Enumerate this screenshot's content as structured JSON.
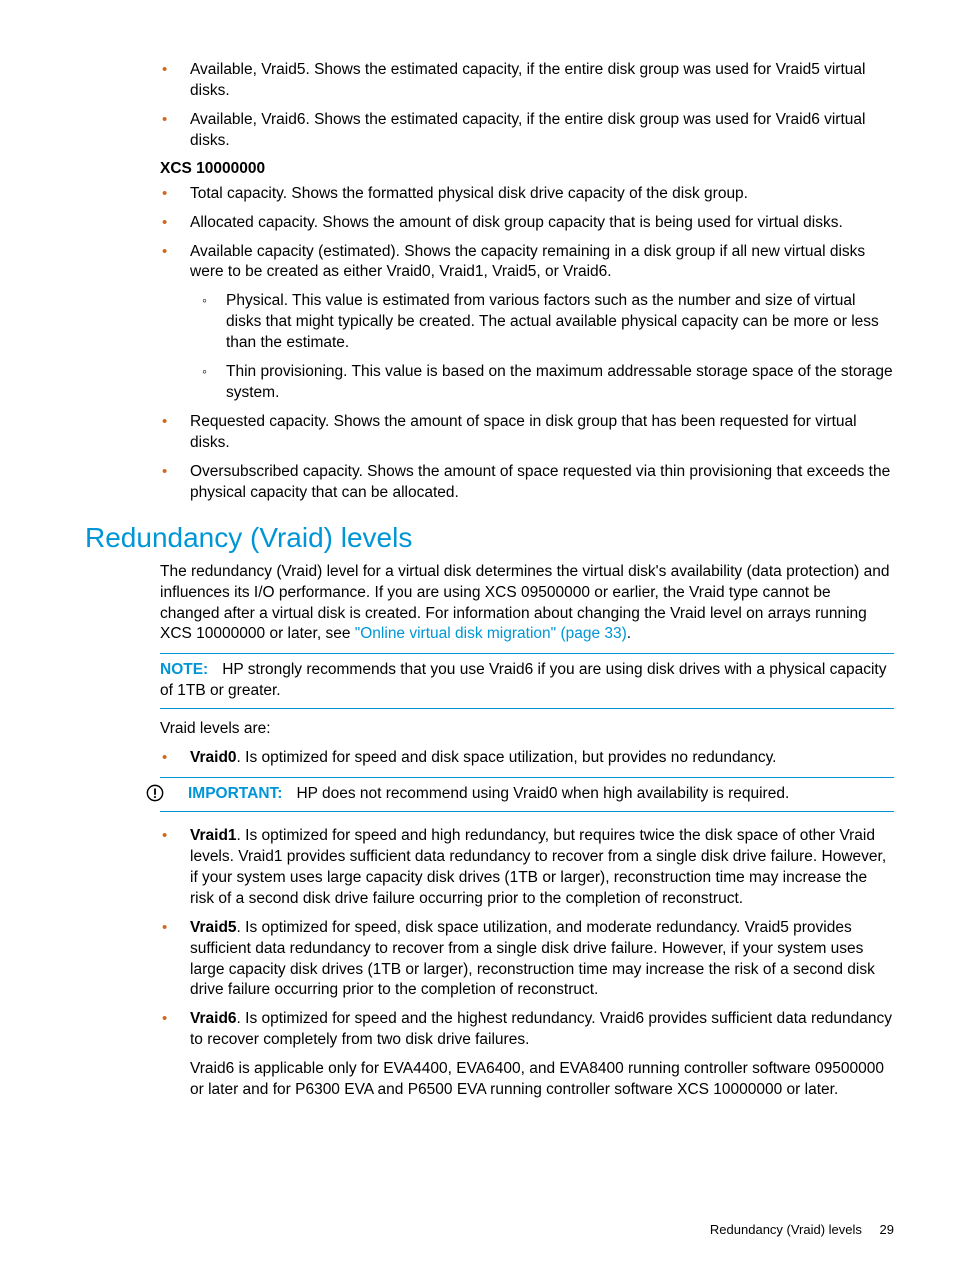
{
  "top_list": [
    "Available, Vraid5. Shows the estimated capacity, if the entire disk group was used for Vraid5 virtual disks.",
    "Available, Vraid6. Shows the estimated capacity, if the entire disk group was used for Vraid6 virtual disks."
  ],
  "xcs_heading": "XCS 10000000",
  "xcs_list": {
    "i0": "Total capacity. Shows the formatted physical disk drive capacity of the disk group.",
    "i1": "Allocated capacity. Shows the amount of disk group capacity that is being used for virtual disks.",
    "i2": "Available capacity (estimated). Shows the capacity remaining in a disk group if all new virtual disks were to be created as either Vraid0, Vraid1, Vraid5, or Vraid6.",
    "i2_sub0": "Physical. This value is estimated from various factors such as the number and size of virtual disks that might typically be created. The actual available physical capacity can be more or less than the estimate.",
    "i2_sub1": "Thin provisioning. This value is based on the maximum addressable storage space of the storage system.",
    "i3": "Requested capacity. Shows the amount of space in disk group that has been requested for virtual disks.",
    "i4": "Oversubscribed capacity. Shows the amount of space requested via thin provisioning that exceeds the physical capacity that can be allocated."
  },
  "section_title": "Redundancy (Vraid) levels",
  "intro_text_pre": "The redundancy (Vraid) level for a virtual disk determines the virtual disk's availability (data protection) and influences its I/O performance. If you are using XCS 09500000 or earlier, the Vraid type cannot be changed after a virtual disk is created. For information about changing the Vraid level on arrays running XCS 10000000 or later, see ",
  "intro_link": "\"Online virtual disk migration\" (page 33)",
  "intro_text_post": ".",
  "note_label": "NOTE:",
  "note_text": "HP strongly recommends that you use Vraid6 if you are using disk drives with a physical capacity of 1TB or greater.",
  "levels_intro": "Vraid levels are:",
  "vraid0_label": "Vraid0",
  "vraid0_text": ". Is optimized for speed and disk space utilization, but provides no redundancy.",
  "important_label": "IMPORTANT:",
  "important_text": "HP does not recommend using Vraid0 when high availability is required.",
  "vraid1_label": "Vraid1",
  "vraid1_text": ". Is optimized for speed and high redundancy, but requires twice the disk space of other Vraid levels. Vraid1 provides sufficient data redundancy to recover from a single disk drive failure. However, if your system uses large capacity disk drives (1TB or larger), reconstruction time may increase the risk of a second disk drive failure occurring prior to the completion of reconstruct.",
  "vraid5_label": "Vraid5",
  "vraid5_text": ". Is optimized for speed, disk space utilization, and moderate redundancy. Vraid5 provides sufficient data redundancy to recover from a single disk drive failure. However, if your system uses large capacity disk drives (1TB or larger), reconstruction time may increase the risk of a second disk drive failure occurring prior to the completion of reconstruct.",
  "vraid6_label": "Vraid6",
  "vraid6_text": ". Is optimized for speed and the highest redundancy. Vraid6 provides sufficient data redundancy to recover completely from two disk drive failures.",
  "vraid6_extra": "Vraid6 is applicable only for EVA4400, EVA6400, and EVA8400 running controller software 09500000 or later and for P6300 EVA and P6500 EVA running controller software XCS 10000000 or later.",
  "footer_text": "Redundancy (Vraid) levels",
  "footer_page": "29"
}
